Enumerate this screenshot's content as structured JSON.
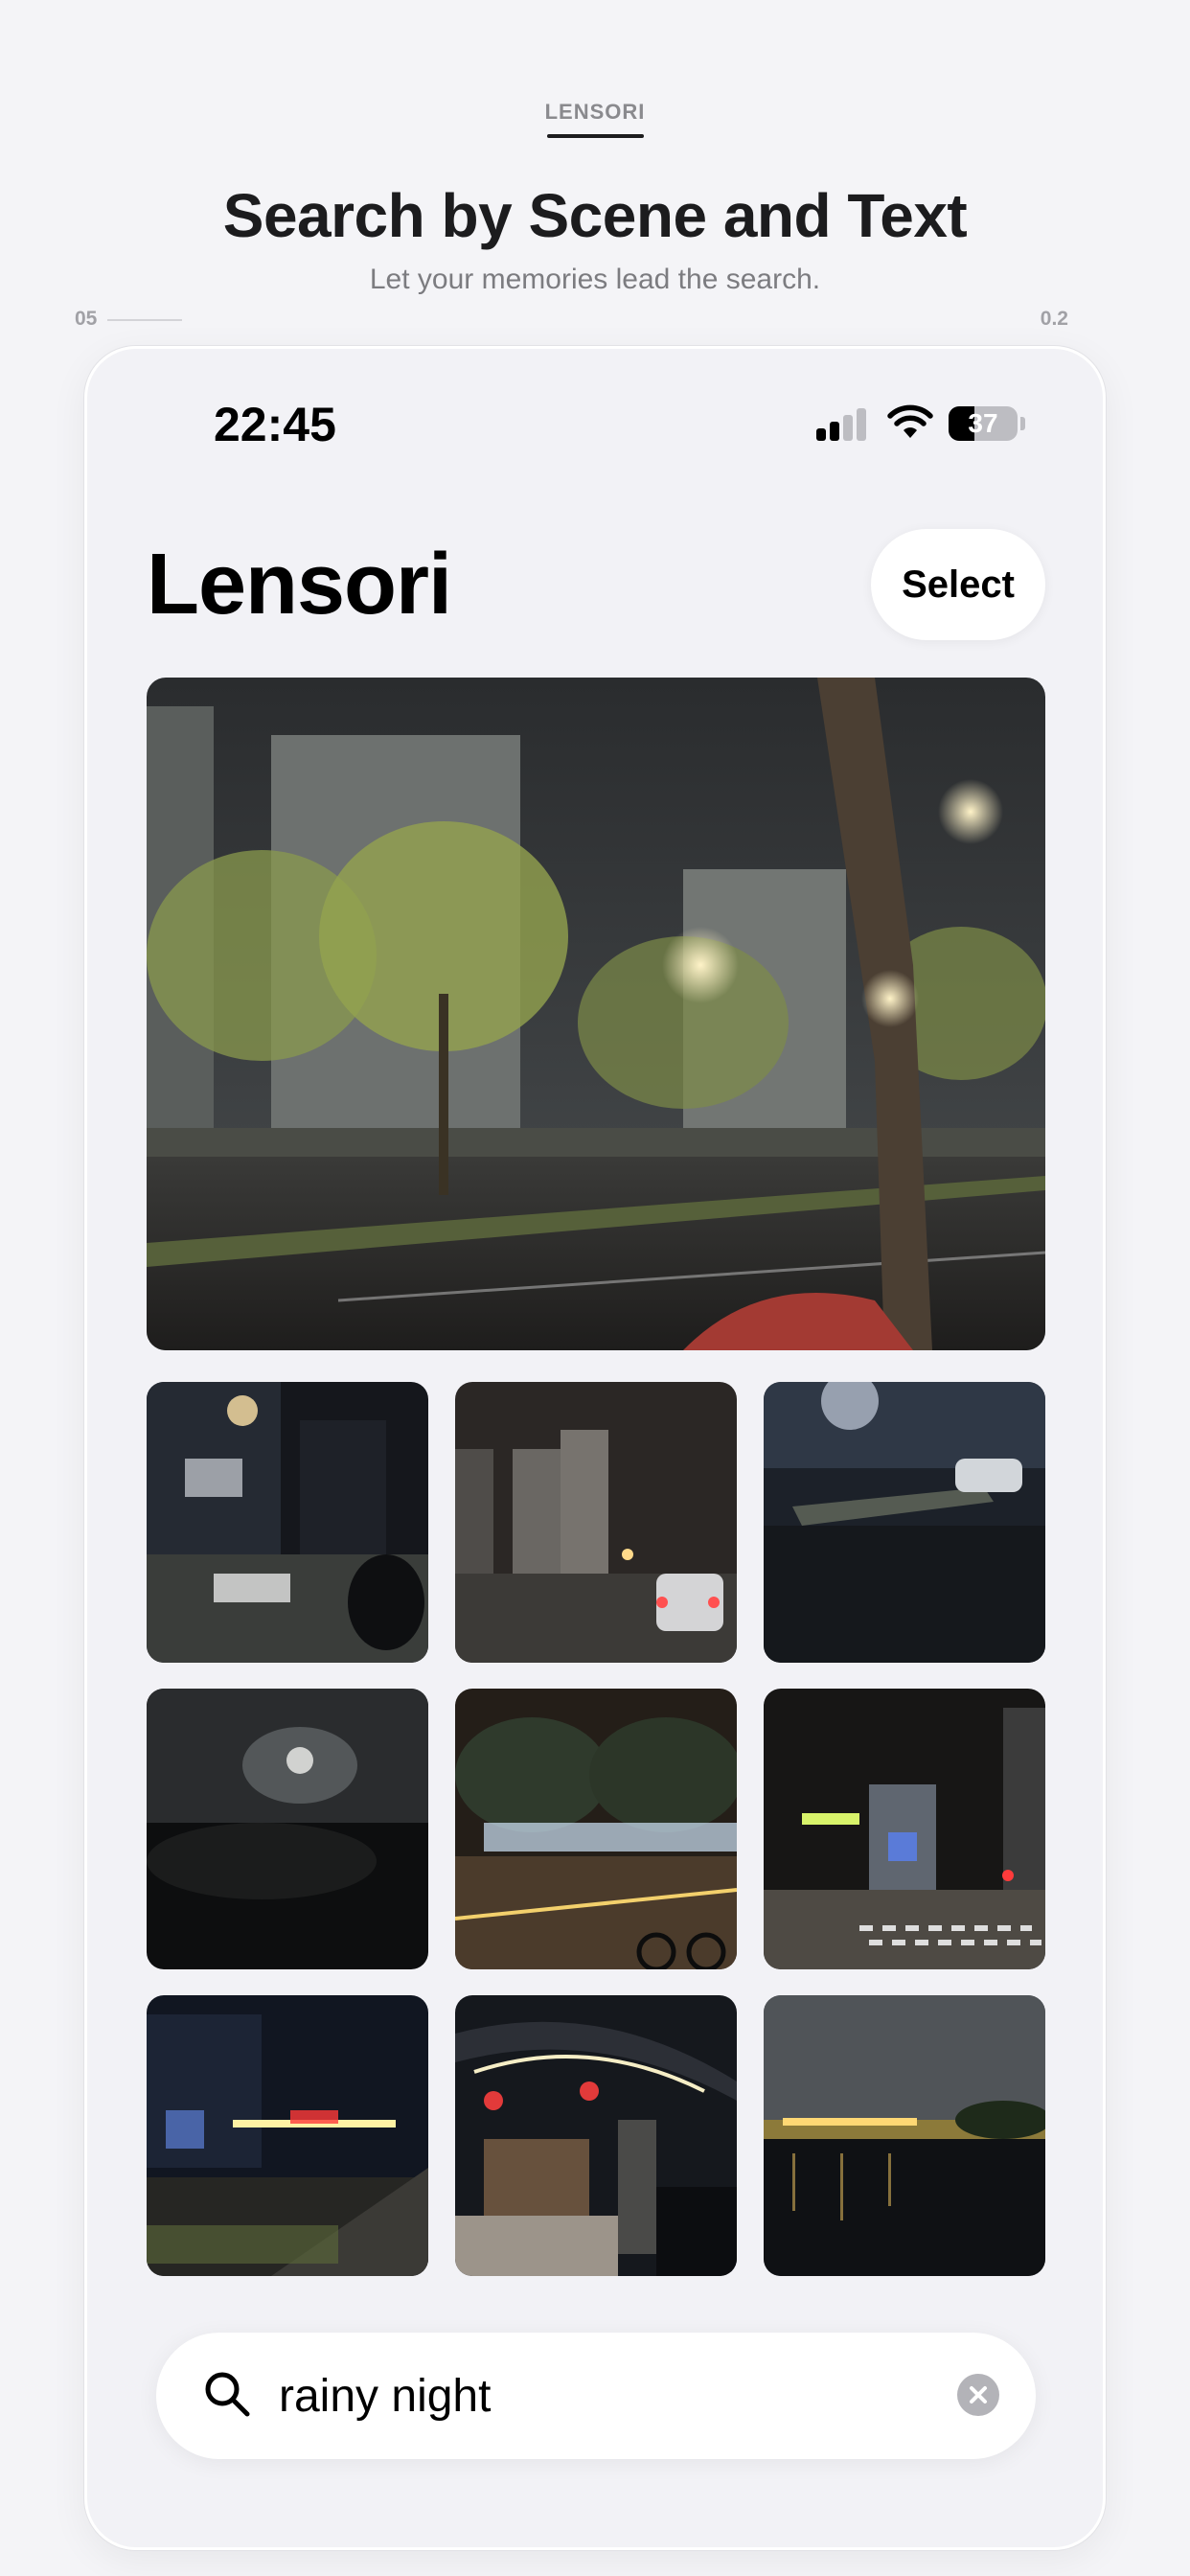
{
  "header": {
    "brand": "LENSORI",
    "headline": "Search by Scene and Text",
    "subhead": "Let your memories lead the search.",
    "page_number": "05",
    "version": "0.2"
  },
  "status_bar": {
    "time": "22:45",
    "battery_percent": "37",
    "battery_level": 0.37,
    "signal_bars": 2
  },
  "app": {
    "title": "Lensori",
    "select_label": "Select"
  },
  "photos": {
    "hero": "photo-rainy-street-trees",
    "grid": [
      "photo-night-street-signs",
      "photo-night-traffic-towers",
      "photo-wet-curb-parked-car",
      "photo-blurry-dark-street",
      "photo-lit-storefronts-bike",
      "photo-city-crossing",
      "photo-lit-promenade",
      "photo-lantern-entrance",
      "photo-river-night-lights"
    ]
  },
  "search": {
    "value": "rainy night",
    "icon": "search-icon",
    "clear_icon": "clear-icon"
  },
  "colors": {
    "background": "#f4f4f7",
    "card": "#ffffff",
    "text": "#111111",
    "muted": "#8a8a8e"
  }
}
